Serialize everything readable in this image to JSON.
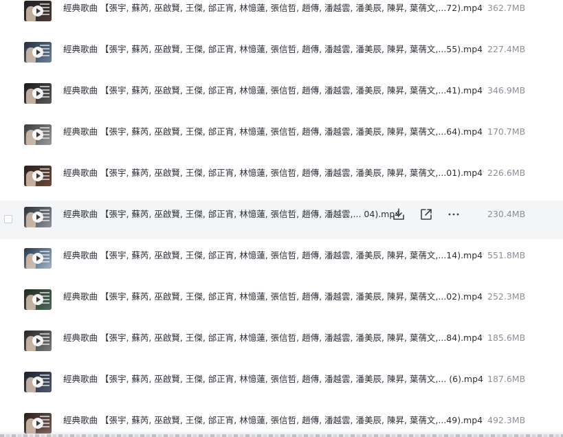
{
  "files": [
    {
      "name": "經典歌曲 【張宇, 蘇芮, 巫啟賢, 王傑, 邰正宵, 林憶蓮, 張信哲, 趙傳, 潘越雲, 潘美辰, 陳昇, 葉蒨文,...72).mp4",
      "size": "362.7MB"
    },
    {
      "name": "經典歌曲 【張宇, 蘇芮, 巫啟賢, 王傑, 邰正宵, 林憶蓮, 張信哲, 趙傳, 潘越雲, 潘美辰, 陳昇, 葉蒨文,...55).mp4",
      "size": "227.4MB"
    },
    {
      "name": "經典歌曲 【張宇, 蘇芮, 巫啟賢, 王傑, 邰正宵, 林憶蓮, 張信哲, 趙傳, 潘越雲, 潘美辰, 陳昇, 葉蒨文,...41).mp4",
      "size": "346.9MB"
    },
    {
      "name": "經典歌曲 【張宇, 蘇芮, 巫啟賢, 王傑, 邰正宵, 林憶蓮, 張信哲, 趙傳, 潘越雲, 潘美辰, 陳昇, 葉蒨文,...64).mp4",
      "size": "170.7MB"
    },
    {
      "name": "經典歌曲 【張宇, 蘇芮, 巫啟賢, 王傑, 邰正宵, 林憶蓮, 張信哲, 趙傳, 潘越雲, 潘美辰, 陳昇, 葉蒨文,...01).mp4",
      "size": "226.6MB"
    },
    {
      "name": "經典歌曲 【張宇, 蘇芮, 巫啟賢, 王傑, 邰正宵, 林憶蓮, 張信哲, 趙傳, 潘越雲,... 04).mp4",
      "size": "230.4MB"
    },
    {
      "name": "經典歌曲 【張宇, 蘇芮, 巫啟賢, 王傑, 邰正宵, 林憶蓮, 張信哲, 趙傳, 潘越雲, 潘美辰, 陳昇, 葉蒨文,...14).mp4",
      "size": "551.8MB"
    },
    {
      "name": "經典歌曲 【張宇, 蘇芮, 巫啟賢, 王傑, 邰正宵, 林憶蓮, 張信哲, 趙傳, 潘越雲, 潘美辰, 陳昇, 葉蒨文,...02).mp4",
      "size": "252.3MB"
    },
    {
      "name": "經典歌曲 【張宇, 蘇芮, 巫啟賢, 王傑, 邰正宵, 林憶蓮, 張信哲, 趙傳, 潘越雲, 潘美辰, 陳昇, 葉蒨文,...84).mp4",
      "size": "185.6MB"
    },
    {
      "name": "經典歌曲 【張宇, 蘇芮, 巫啟賢, 王傑, 邰正宵, 林憶蓮, 張信哲, 趙傳, 潘越雲, 潘美辰, 陳昇, 葉蒨文,... (6).mp4",
      "size": "187.6MB"
    },
    {
      "name": "經典歌曲 【張宇, 蘇芮, 巫啟賢, 王傑, 邰正宵, 林憶蓮, 張信哲, 趙傳, 潘越雲, 潘美辰, 陳昇, 葉蒨文,...49).mp4",
      "size": "492.3MB"
    }
  ],
  "hovered_index": 5,
  "row_actions": {
    "download_icon": "download-icon",
    "share_icon": "share-icon",
    "more_icon": "more-icon"
  },
  "colors": {
    "hover_background": "#f4f5f7",
    "name_text": "#2b2f36",
    "size_text": "#8a8f99",
    "icon": "#3b3f46"
  }
}
